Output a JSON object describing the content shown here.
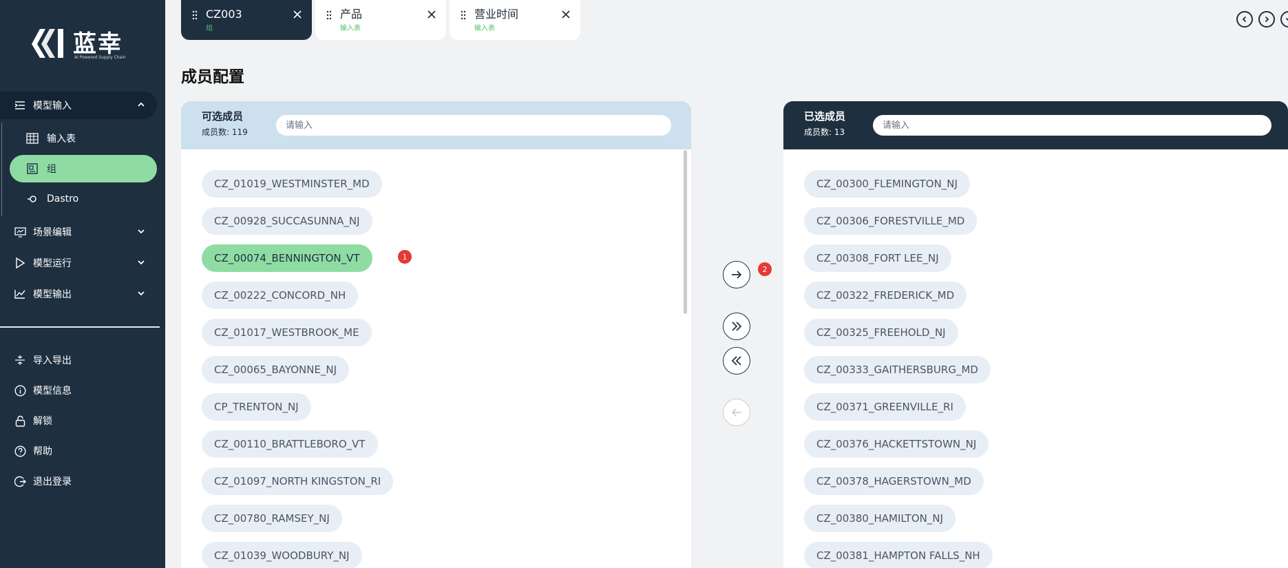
{
  "brand": {
    "name": "蓝幸",
    "tagline": "AI Powered Supply Chain"
  },
  "sidebar": {
    "groups": [
      {
        "label": "模型输入",
        "icon": "list-indent-icon",
        "expanded": true,
        "children": [
          {
            "label": "输入表",
            "icon": "table-grid-icon"
          },
          {
            "label": "组",
            "icon": "group-box-icon",
            "selected": true
          },
          {
            "label": "Dastro",
            "icon": "dastro-icon"
          }
        ]
      },
      {
        "label": "场景编辑",
        "icon": "scene-monitor-icon"
      },
      {
        "label": "模型运行",
        "icon": "play-icon"
      },
      {
        "label": "模型输出",
        "icon": "line-chart-icon"
      }
    ],
    "bottom": [
      {
        "label": "导入导出",
        "icon": "import-export-icon"
      },
      {
        "label": "模型信息",
        "icon": "info-icon"
      },
      {
        "label": "解锁",
        "icon": "unlock-icon"
      },
      {
        "label": "帮助",
        "icon": "help-icon"
      },
      {
        "label": "退出登录",
        "icon": "logout-icon"
      }
    ]
  },
  "tabs": [
    {
      "title": "CZ003",
      "subtitle": "组",
      "active": true
    },
    {
      "title": "产品",
      "subtitle": "输入表",
      "active": false
    },
    {
      "title": "营业时间",
      "subtitle": "输入表",
      "active": false
    }
  ],
  "page_title": "成员配置",
  "available": {
    "title": "可选成员",
    "count_label": "成员数: ",
    "count": "119",
    "search_placeholder": "请输入",
    "items": [
      "CZ_01019_WESTMINSTER_MD",
      "CZ_00928_SUCCASUNNA_NJ",
      "CZ_00074_BENNINGTON_VT",
      "CZ_00222_CONCORD_NH",
      "CZ_01017_WESTBROOK_ME",
      "CZ_00065_BAYONNE_NJ",
      "CP_TRENTON_NJ",
      "CZ_00110_BRATTLEBORO_VT",
      "CZ_01097_NORTH KINGSTON_RI",
      "CZ_00780_RAMSEY_NJ",
      "CZ_01039_WOODBURY_NJ"
    ],
    "selected_item": "CZ_00074_BENNINGTON_VT"
  },
  "selected": {
    "title": "已选成员",
    "count_label": "成员数: ",
    "count": "13",
    "search_placeholder": "请输入",
    "items": [
      "CZ_00300_FLEMINGTON_NJ",
      "CZ_00306_FORESTVILLE_MD",
      "CZ_00308_FORT LEE_NJ",
      "CZ_00322_FREDERICK_MD",
      "CZ_00325_FREEHOLD_NJ",
      "CZ_00333_GAITHERSBURG_MD",
      "CZ_00371_GREENVILLE_RI",
      "CZ_00376_HACKETTSTOWN_NJ",
      "CZ_00378_HAGERSTOWN_MD",
      "CZ_00380_HAMILTON_NJ",
      "CZ_00381_HAMPTON FALLS_NH"
    ]
  },
  "badges": {
    "step1": "1",
    "step2": "2"
  },
  "colors": {
    "sidebar": "#1e2f40",
    "accent_green": "#8fdca3",
    "badge_red": "#e53935",
    "panel_head_light": "#cde0ee"
  }
}
